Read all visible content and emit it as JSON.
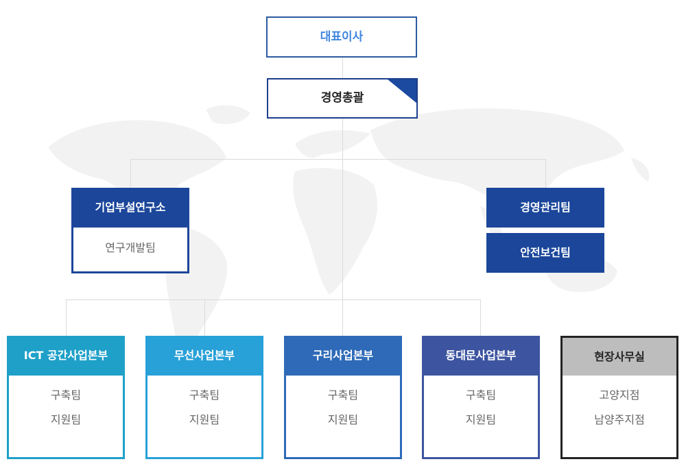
{
  "ceo": {
    "label": "대표이사"
  },
  "general_manager": {
    "label": "경영총괄"
  },
  "research": {
    "title": "기업부설연구소",
    "items": [
      "연구개발팀"
    ]
  },
  "management": {
    "items": [
      "경영관리팀",
      "안전보건팀"
    ]
  },
  "divisions": [
    {
      "title": "ICT 공간사업본부",
      "items": [
        "구축팀",
        "지원팀"
      ],
      "color": "#1ea0c8"
    },
    {
      "title": "무선사업본부",
      "items": [
        "구축팀",
        "지원팀"
      ],
      "color": "#28a0d8"
    },
    {
      "title": "구리사업본부",
      "items": [
        "구축팀",
        "지원팀"
      ],
      "color": "#2e6ab8"
    },
    {
      "title": "동대문사업본부",
      "items": [
        "구축팀",
        "지원팀"
      ],
      "color": "#3d55a0"
    },
    {
      "title": "현장사무실",
      "items": [
        "고양지점",
        "남양주지점"
      ],
      "color": "#222222",
      "head_bg": "#bdbdbd"
    }
  ]
}
